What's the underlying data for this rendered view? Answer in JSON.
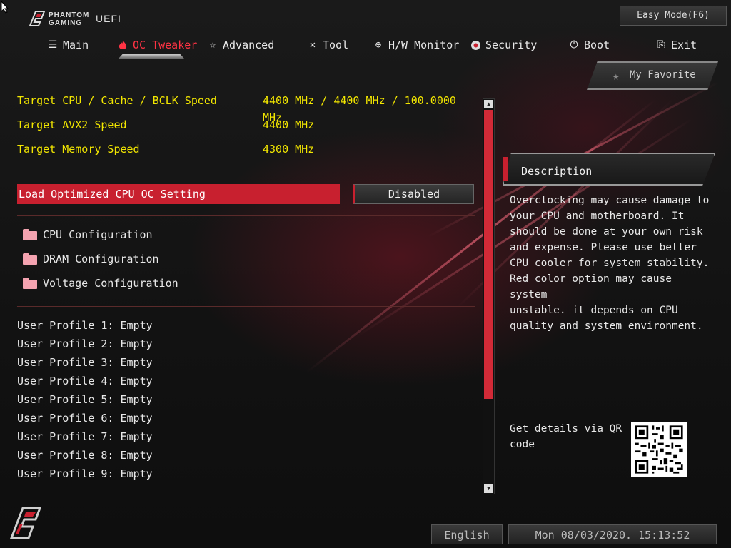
{
  "header": {
    "brand_line1": "PHANTOM",
    "brand_line2": "GAMING",
    "brand_uefi": "UEFI",
    "easy_mode": "Easy Mode(F6)"
  },
  "nav": [
    {
      "label": "Main",
      "icon": "list-icon"
    },
    {
      "label": "OC Tweaker",
      "icon": "flame-icon",
      "active": true
    },
    {
      "label": "Advanced",
      "icon": "star-icon"
    },
    {
      "label": "Tool",
      "icon": "tools-icon"
    },
    {
      "label": "H/W Monitor",
      "icon": "crosshair-icon"
    },
    {
      "label": "Security",
      "icon": "shield-icon"
    },
    {
      "label": "Boot",
      "icon": "power-icon"
    },
    {
      "label": "Exit",
      "icon": "exit-icon"
    }
  ],
  "favorite": {
    "label": "My Favorite"
  },
  "targets": [
    {
      "label": "Target CPU / Cache / BCLK Speed",
      "value": "4400 MHz / 4400 MHz / 100.0000 MHz"
    },
    {
      "label": "Target AVX2 Speed",
      "value": "4400 MHz"
    },
    {
      "label": "Target Memory Speed",
      "value": "4300 MHz"
    }
  ],
  "load_optimized": {
    "label": "Load Optimized CPU OC Setting",
    "value": "Disabled"
  },
  "folders": [
    {
      "label": "CPU Configuration"
    },
    {
      "label": "DRAM Configuration"
    },
    {
      "label": "Voltage Configuration"
    }
  ],
  "profiles": [
    "User Profile 1: Empty",
    "User Profile 2: Empty",
    "User Profile 3: Empty",
    "User Profile 4: Empty",
    "User Profile 5: Empty",
    "User Profile 6: Empty",
    "User Profile 7: Empty",
    "User Profile 8: Empty",
    "User Profile 9: Empty"
  ],
  "description": {
    "title": "Description",
    "text": "Overclocking may cause damage to\nyour CPU and motherboard. It\nshould be done at your own risk\nand expense. Please use better\nCPU cooler for system stability.\nRed color option may cause system\nunstable. it depends on CPU\nquality and system environment."
  },
  "qr": {
    "text": "Get details via QR code"
  },
  "footer": {
    "language": "English",
    "datetime": "Mon 08/03/2020. 15:13:52"
  },
  "colors": {
    "accent": "#c8202f",
    "highlight_text": "#f2e600",
    "active_tab": "#ff3344"
  }
}
